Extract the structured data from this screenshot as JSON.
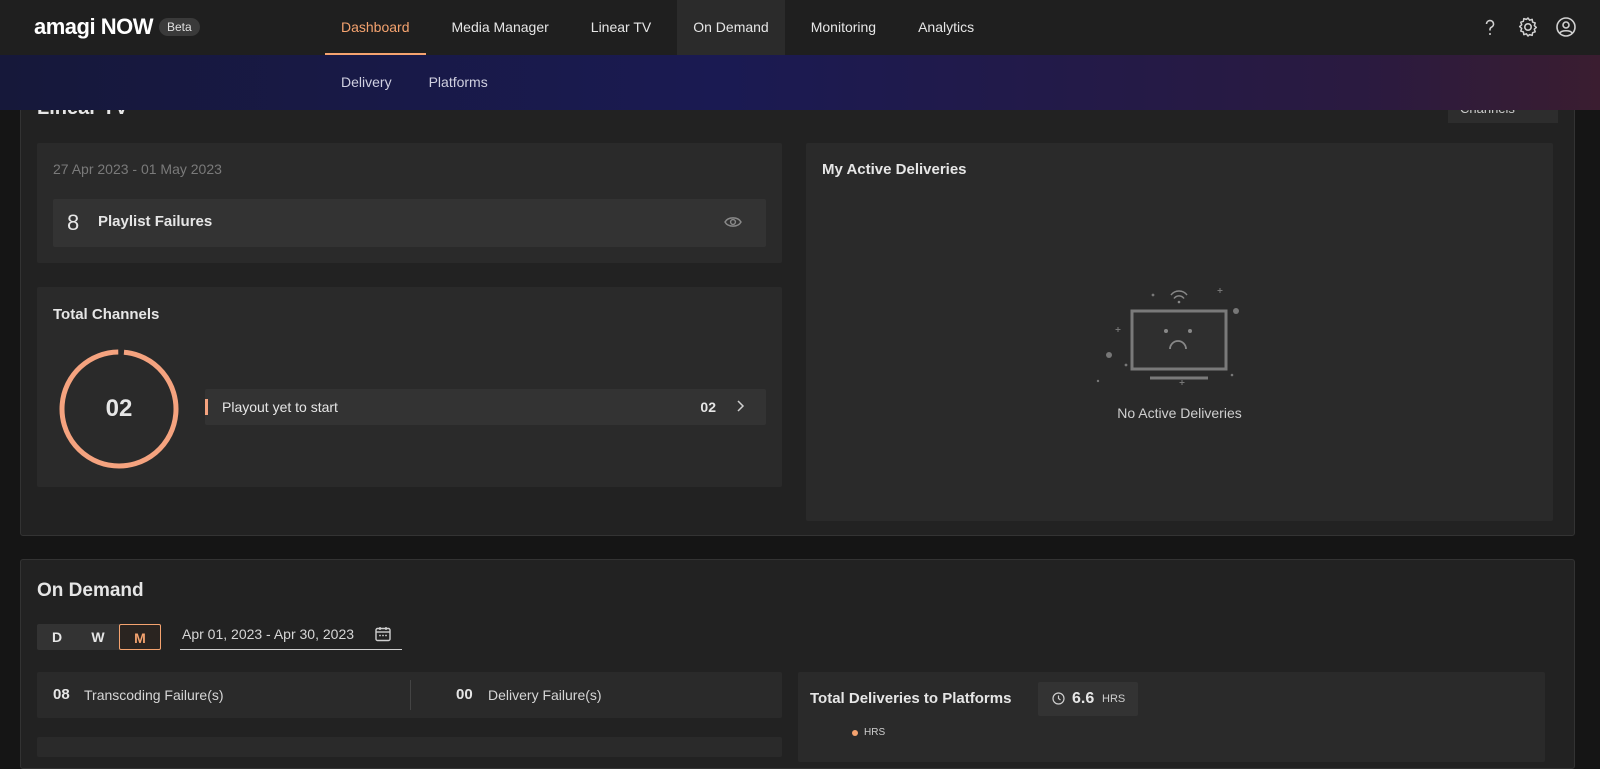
{
  "header": {
    "brand": "amagi NOW",
    "badge": "Beta",
    "nav": [
      "Dashboard",
      "Media Manager",
      "Linear TV",
      "On Demand",
      "Monitoring",
      "Analytics"
    ],
    "active_nav": "Dashboard",
    "icons": [
      "help-icon",
      "gear-icon",
      "user-icon"
    ]
  },
  "subnav": [
    "Delivery",
    "Platforms"
  ],
  "linear_tv": {
    "title": "Linear TV",
    "dropdown_label": "Channels",
    "date_range": "27 Apr 2023 - 01 May 2023",
    "playlist_failures": {
      "count": "8",
      "label": "Playlist Failures"
    },
    "total_channels": {
      "title": "Total Channels",
      "value": "02",
      "rows": [
        {
          "label": "Playout yet to start",
          "value": "02"
        }
      ]
    },
    "active_deliveries": {
      "title": "My Active Deliveries",
      "empty_text": "No Active Deliveries"
    }
  },
  "on_demand": {
    "title": "On Demand",
    "range_buttons": [
      "D",
      "W",
      "M"
    ],
    "active_range": "M",
    "date_range": "Apr 01, 2023 - Apr 30, 2023",
    "transcoding": {
      "count": "08",
      "label": "Transcoding Failure(s)"
    },
    "delivery": {
      "count": "00",
      "label": "Delivery Failure(s)"
    },
    "total_deliveries": {
      "title": "Total Deliveries to Platforms",
      "value": "6.6",
      "unit": "HRS",
      "legend": "HRS"
    }
  },
  "colors": {
    "accent": "#f5a36f",
    "ring": "#f5a37f"
  }
}
